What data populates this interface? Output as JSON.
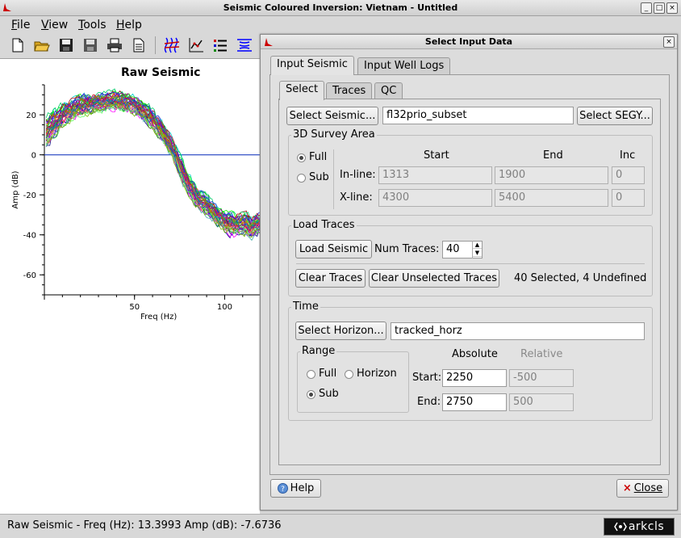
{
  "window": {
    "title": "Seismic Coloured Inversion: Vietnam - Untitled",
    "buttons": [
      "_",
      "□",
      "×"
    ]
  },
  "menubar": [
    {
      "label": "File",
      "mnemonic": "F",
      "rest": "ile"
    },
    {
      "label": "View",
      "mnemonic": "V",
      "rest": "iew"
    },
    {
      "label": "Tools",
      "mnemonic": "T",
      "rest": "ools"
    },
    {
      "label": "Help",
      "mnemonic": "H",
      "rest": "elp"
    }
  ],
  "toolbar": [
    "new-file",
    "open-folder",
    "save",
    "save-as",
    "print",
    "document",
    "seismic-traces",
    "chart",
    "list",
    "wavelet"
  ],
  "chart_data": {
    "type": "line",
    "title": "Raw Seismic",
    "xlabel": "Freq (Hz)",
    "ylabel": "Amp (dB)",
    "xlim": [
      0,
      125
    ],
    "ylim": [
      -70,
      35
    ],
    "xticks": [
      50,
      100
    ],
    "yticks": [
      20,
      0,
      -20,
      -40,
      -60
    ],
    "reference_line_y": 0,
    "num_traces": 40,
    "envelope": {
      "x": [
        0,
        5,
        10,
        20,
        30,
        40,
        50,
        60,
        65,
        70,
        75,
        80,
        85,
        90,
        95,
        100,
        105,
        110,
        115,
        120,
        125
      ],
      "mean": [
        10,
        15,
        20,
        25,
        26,
        27,
        25,
        18,
        12,
        5,
        -5,
        -15,
        -22,
        -25,
        -30,
        -33,
        -35,
        -34,
        -36,
        -34,
        -35
      ],
      "spread": [
        12,
        12,
        10,
        9,
        8,
        8,
        8,
        9,
        9,
        9,
        10,
        9,
        9,
        9,
        9,
        9,
        10,
        10,
        9,
        9,
        9
      ]
    },
    "grid": false
  },
  "status": {
    "text": "Raw Seismic  -  Freq (Hz): 13.3993  Amp (dB): -7.6736",
    "logo": "arkcls"
  },
  "dialog": {
    "title": "Select Input Data",
    "tabs_top": [
      "Input Seismic",
      "Input Well Logs"
    ],
    "tabs_sub": [
      "Select",
      "Traces",
      "QC"
    ],
    "select_seismic_button": "Select Seismic...",
    "seismic_name": "fl32prio_subset",
    "select_segy_button": "Select SEGY...",
    "survey": {
      "title": "3D Survey Area",
      "full_label": "Full",
      "sub_label": "Sub",
      "selected": "Full",
      "col_start": "Start",
      "col_end": "End",
      "col_inc": "Inc",
      "inline_label": "In-line:",
      "inline_start": "1313",
      "inline_end": "1900",
      "inline_inc": "0",
      "xline_label": "X-line:",
      "xline_start": "4300",
      "xline_end": "5400",
      "xline_inc": "0"
    },
    "load": {
      "title": "Load Traces",
      "load_button": "Load Seismic",
      "num_traces_label": "Num Traces:",
      "num_traces": "40",
      "clear_button": "Clear Traces",
      "clear_unselected_button": "Clear Unselected Traces",
      "summary": "40 Selected, 4 Undefined"
    },
    "time": {
      "title": "Time",
      "select_horizon_button": "Select Horizon...",
      "horizon_name": "tracked_horz",
      "range_title": "Range",
      "range_full": "Full",
      "range_horizon": "Horizon",
      "range_sub": "Sub",
      "range_selected": "Sub",
      "absolute_label": "Absolute",
      "relative_label": "Relative",
      "start_label": "Start:",
      "start_abs": "2250",
      "start_rel": "-500",
      "end_label": "End:",
      "end_abs": "2750",
      "end_rel": "500"
    },
    "help_button": "Help",
    "close_button": "Close"
  }
}
